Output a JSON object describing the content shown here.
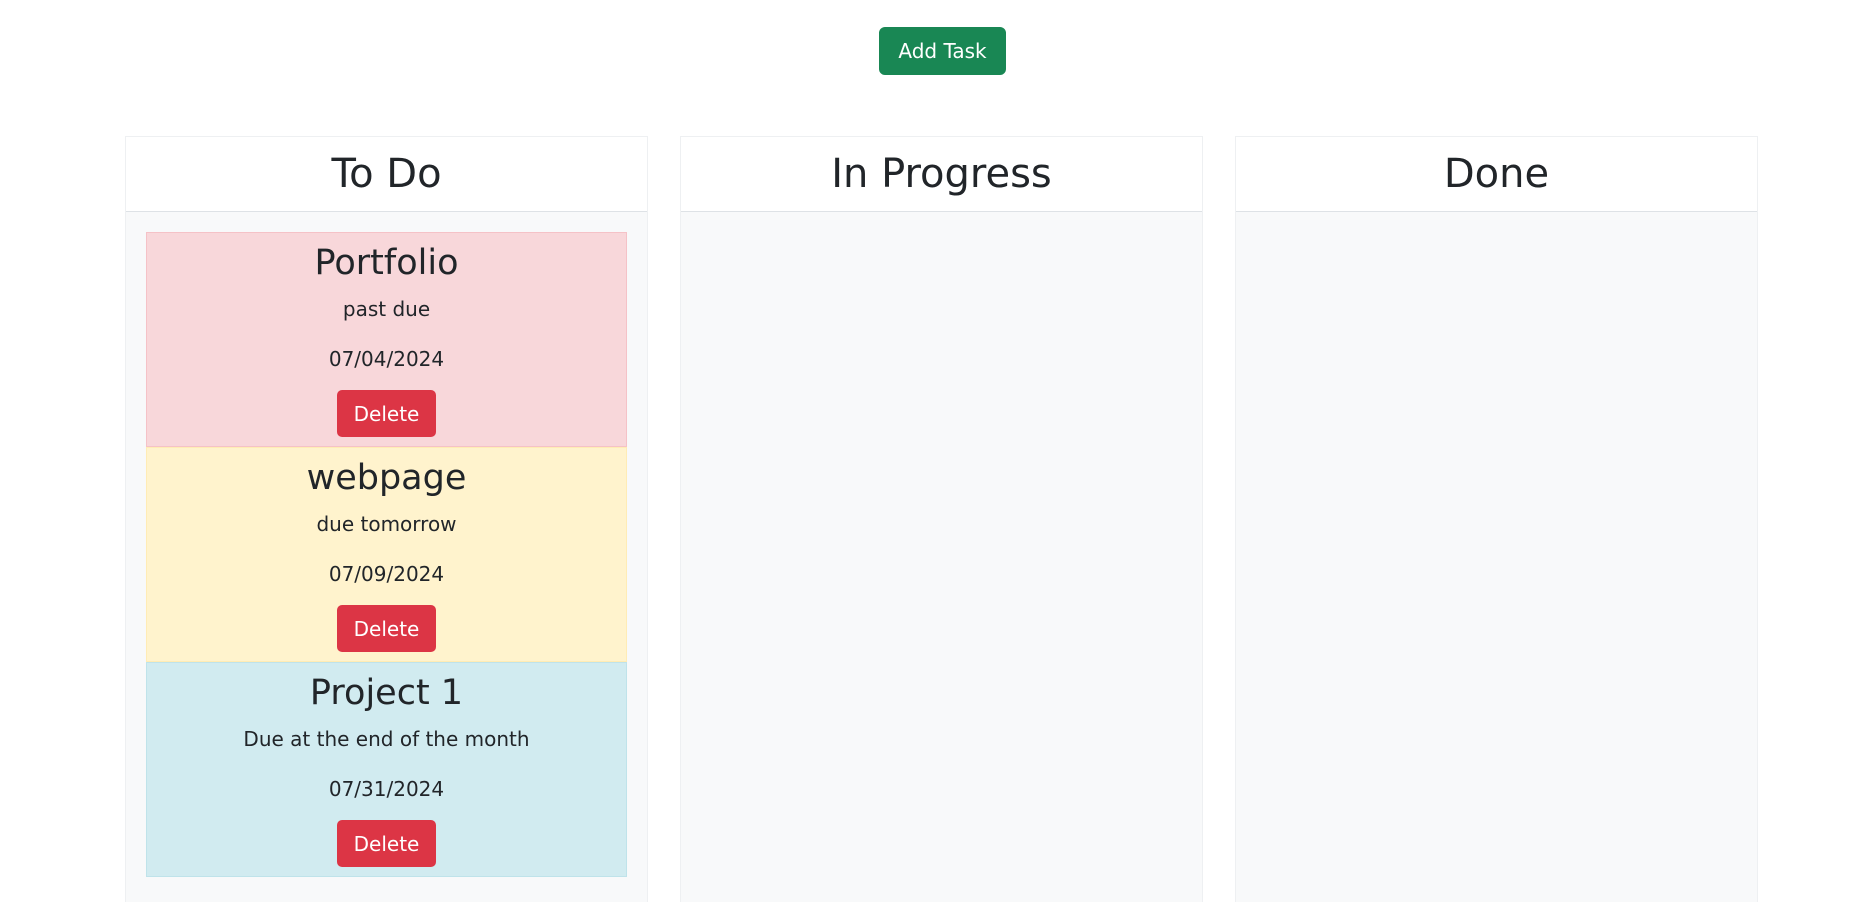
{
  "toolbar": {
    "add_task_label": "Add Task"
  },
  "columns": [
    {
      "title": "To Do",
      "cards": [
        {
          "title": "Portfolio",
          "description": "past due",
          "date": "07/04/2024",
          "delete_label": "Delete",
          "status_color": "#f8d7da"
        },
        {
          "title": "webpage",
          "description": "due tomorrow",
          "date": "07/09/2024",
          "delete_label": "Delete",
          "status_color": "#fff3cd"
        },
        {
          "title": "Project 1",
          "description": "Due at the end of the month",
          "date": "07/31/2024",
          "delete_label": "Delete",
          "status_color": "#d1ebf0"
        }
      ]
    },
    {
      "title": "In Progress",
      "cards": []
    },
    {
      "title": "Done",
      "cards": []
    }
  ],
  "colors": {
    "add_button": "#198754",
    "delete_button": "#dc3545",
    "column_background": "#f8f9fa"
  }
}
